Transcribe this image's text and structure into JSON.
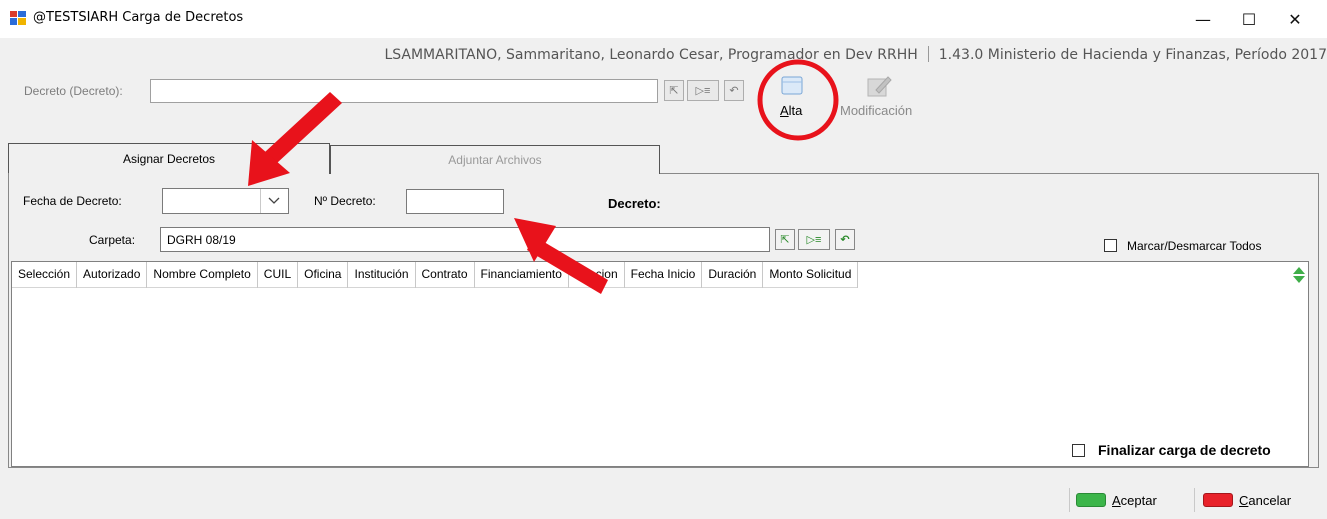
{
  "window": {
    "title": "@TESTSIARH Carga de Decretos",
    "minimize": "—",
    "maximize": "☐",
    "close": "✕"
  },
  "user_info": {
    "user": "LSAMMARITANO, Sammaritano, Leonardo Cesar, Programador en Dev RRHH",
    "version": "1.43.0 Ministerio de Hacienda y Finanzas, Período 2017"
  },
  "decreto_search": {
    "label": "Decreto (Decreto):",
    "value": ""
  },
  "toolbar": {
    "alta_mnemonic": "A",
    "alta_rest": "lta",
    "modificacion_label": "Modificación"
  },
  "tabs": [
    {
      "label": "Asignar Decretos",
      "active": true
    },
    {
      "label": "Adjuntar Archivos",
      "active": false
    }
  ],
  "form": {
    "fecha_label": "Fecha de Decreto:",
    "fecha_value": "",
    "nro_label": "Nº Decreto:",
    "nro_value": "",
    "decreto_label": "Decreto:",
    "carpeta_label": "Carpeta:",
    "carpeta_value": "DGRH 08/19",
    "marcar_label": "Marcar/Desmarcar Todos"
  },
  "grid": {
    "columns": [
      "Selección",
      "Autorizado",
      "Nombre Completo",
      "CUIL",
      "Oficina",
      "Institución",
      "Contrato",
      "Financiamiento",
      "Funcion",
      "Fecha Inicio",
      "Duración",
      "Monto Solicitud"
    ],
    "rows": []
  },
  "finalizar_label": "Finalizar carga de decreto",
  "buttons": {
    "aceptar_mnemonic": "A",
    "aceptar_rest": "ceptar",
    "cancelar_mnemonic": "C",
    "cancelar_rest": "ancelar"
  },
  "colors": {
    "annotation_red": "#e8121b",
    "aceptar_green": "#3cb54a",
    "cancelar_red": "#e8222a"
  }
}
